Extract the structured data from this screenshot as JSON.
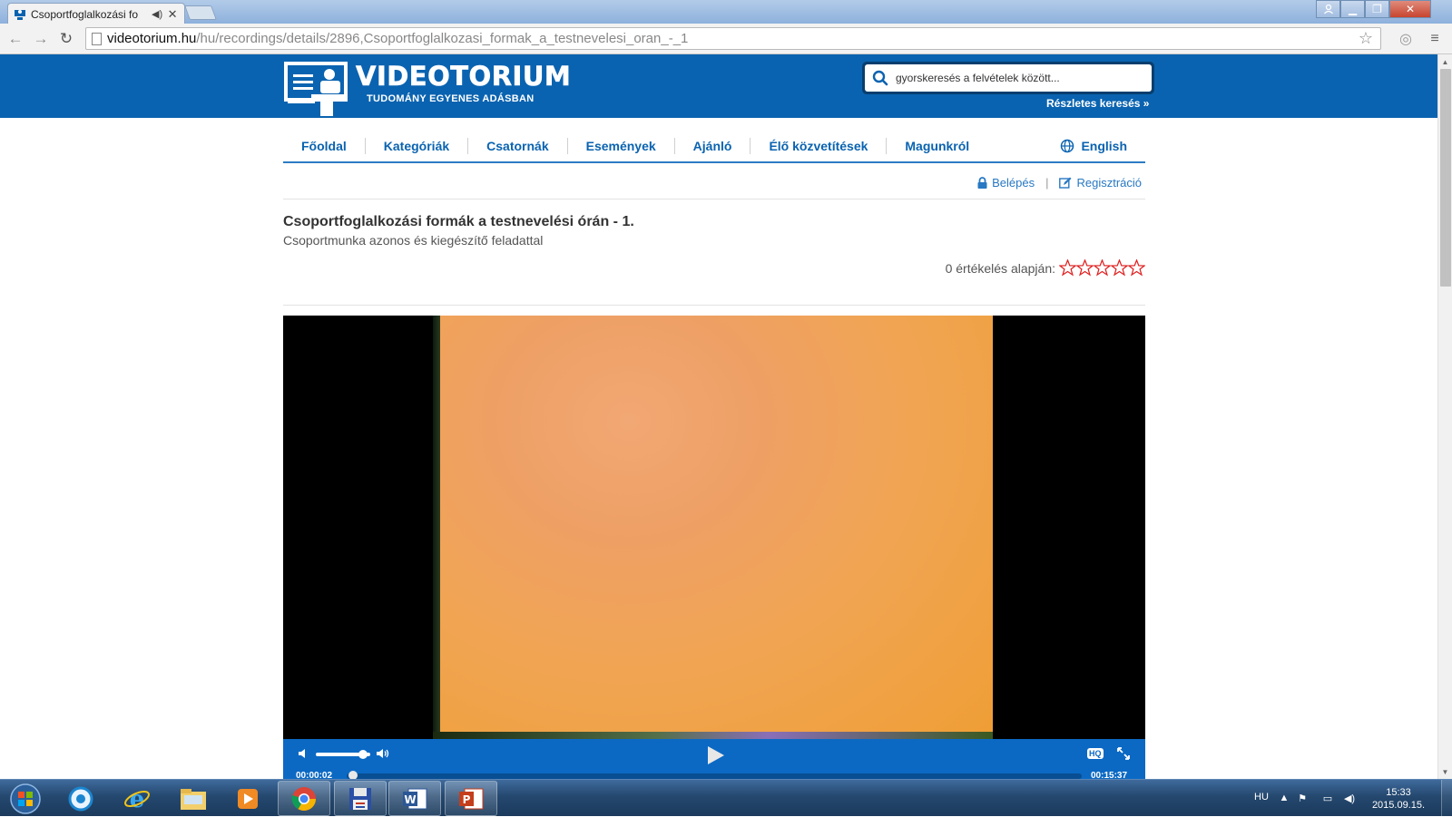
{
  "browser": {
    "tab_title": "Csoportfoglalkozási fo",
    "address_host": "videotorium.hu",
    "address_path": "/hu/recordings/details/2896,Csoportfoglalkozasi_formak_a_testnevelesi_oran_-_1",
    "icons": [
      "back-icon",
      "forward-icon",
      "reload-icon",
      "bookmark-star-icon",
      "extension-icon",
      "menu-icon"
    ]
  },
  "site": {
    "logo_name": "VIDEOTORIUM",
    "logo_slogan": "TUDOMÁNY EGYENES ADÁSBAN",
    "search_placeholder": "gyorskeresés a felvételek között...",
    "advanced_search": "Részletes keresés »",
    "brand_color": "#0a63b0"
  },
  "nav": {
    "items": [
      {
        "label": "Főoldal"
      },
      {
        "label": "Kategóriák"
      },
      {
        "label": "Csatornák"
      },
      {
        "label": "Események"
      },
      {
        "label": "Ajánló"
      },
      {
        "label": "Élő közvetítések"
      },
      {
        "label": "Magunkról"
      }
    ],
    "language": "English"
  },
  "auth": {
    "login": "Belépés",
    "separator": "|",
    "register": "Regisztráció"
  },
  "recording": {
    "title": "Csoportfoglalkozási formák a testnevelési órán - 1.",
    "subtitle": "Csoportmunka azonos és kiegészítő feladattal",
    "rating_text": "0 értékelés alapján:",
    "rating_value": 0,
    "rating_max": 5,
    "star_color": "#e02020"
  },
  "player": {
    "current_time": "00:00:02",
    "total_time": "00:15:37",
    "hq_label": "HQ",
    "volume_fraction": 0.87,
    "progress_fraction": 0.002,
    "controls_color": "#0b69c4"
  },
  "taskbar": {
    "language": "HU",
    "time": "15:33",
    "date": "2015.09.15.",
    "apps": [
      "start-orb",
      "skype",
      "internet-explorer",
      "file-explorer",
      "media-player",
      "chrome",
      "save-app",
      "word",
      "powerpoint"
    ]
  }
}
